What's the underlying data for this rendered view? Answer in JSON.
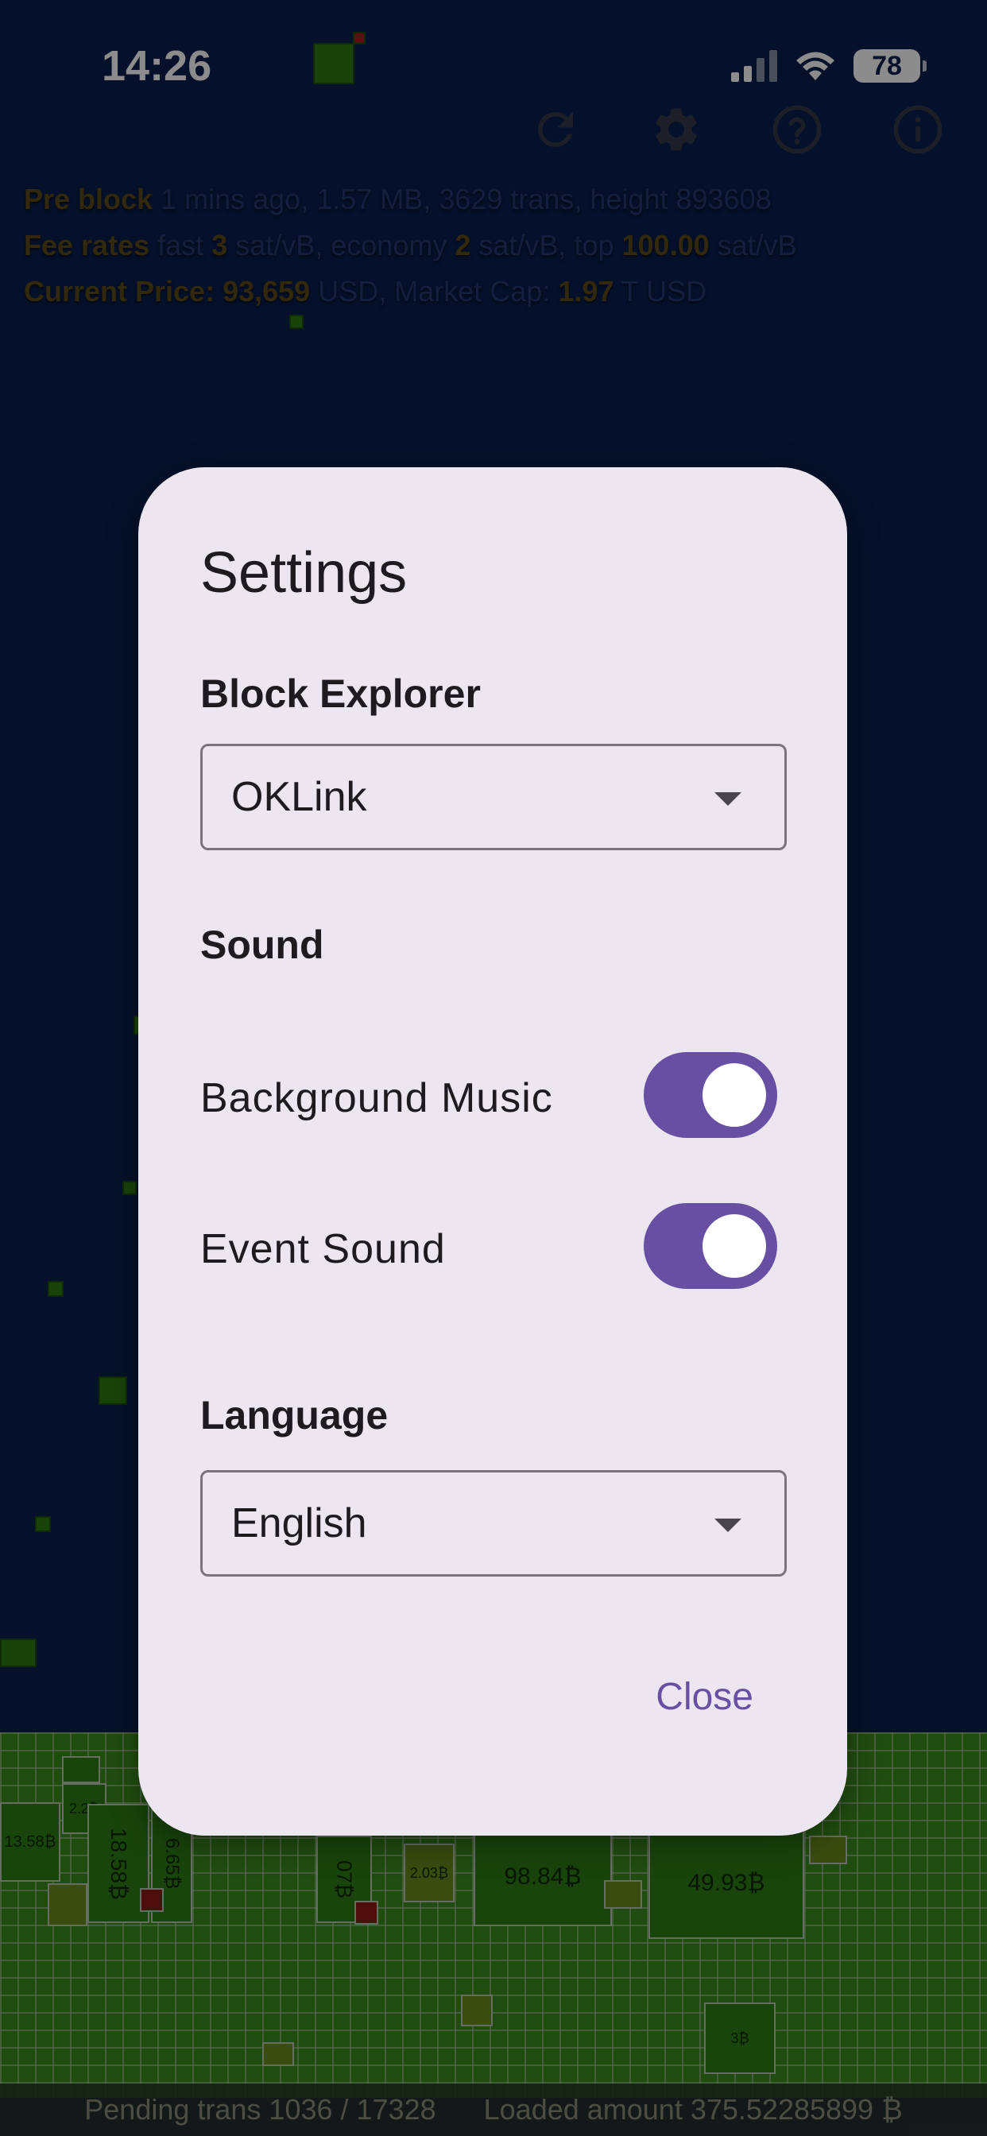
{
  "status_bar": {
    "time": "14:26",
    "battery": "78"
  },
  "info": {
    "pre_block_key": "Pre block",
    "pre_block_value": "1 mins ago, 1.57 MB, 3629 trans, height 893608",
    "fee_key": "Fee rates",
    "fee_fast_label": "fast",
    "fee_fast_value": "3",
    "fee_economy_label": "sat/vB, economy",
    "fee_economy_value": "2",
    "fee_top_label": "sat/vB, top",
    "fee_top_value": "100.00",
    "fee_unit": "sat/vB",
    "price_key": "Current Price:",
    "price_value": "93,659",
    "price_unit": "USD, Market Cap:",
    "cap_value": "1.97",
    "cap_unit": "T USD"
  },
  "mempool": {
    "labels": [
      "2.2₿",
      "13.58₿",
      "18.58₿",
      "6.65₿",
      "07₿",
      "2.03₿",
      "98.84₿",
      "49.93₿",
      "3₿"
    ]
  },
  "footer": {
    "pending": "Pending trans 1036 / 17328",
    "loaded": "Loaded amount 375.52285899 ₿"
  },
  "dialog": {
    "title": "Settings",
    "block_explorer_label": "Block Explorer",
    "block_explorer_value": "OKLink",
    "sound_label": "Sound",
    "background_music_label": "Background Music",
    "background_music_on": true,
    "event_sound_label": "Event Sound",
    "event_sound_on": true,
    "language_label": "Language",
    "language_value": "English",
    "close_label": "Close"
  },
  "colors": {
    "accent": "#6750a4",
    "dialog_bg": "#ece6f0",
    "background": "#0a1f4d"
  }
}
